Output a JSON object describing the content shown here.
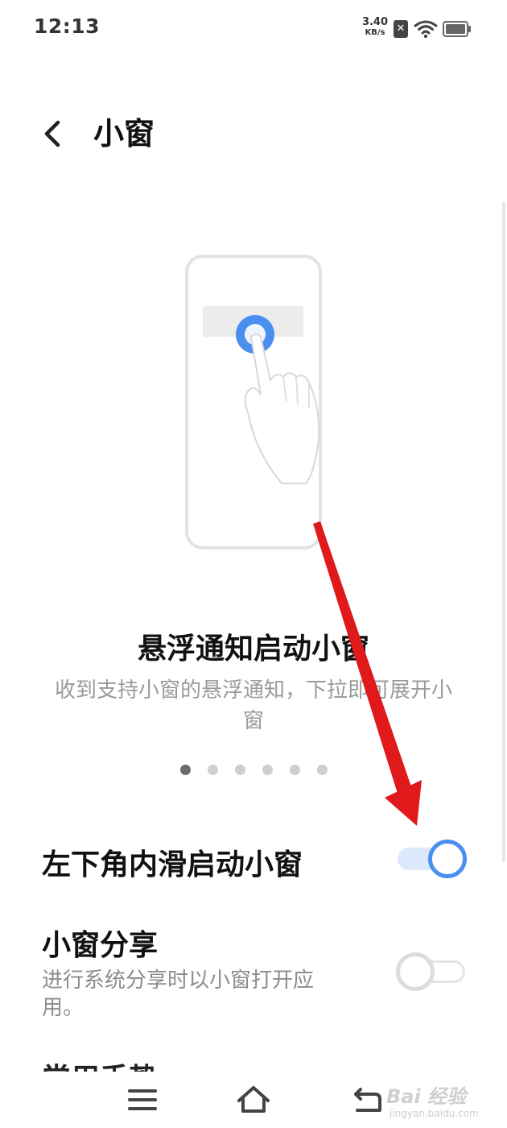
{
  "status_bar": {
    "time": "12:13",
    "net_speed_value": "3.40",
    "net_speed_unit": "KB/s",
    "sim_badge": "✕",
    "icons": [
      "sim-error-icon",
      "wifi-icon",
      "battery-icon"
    ]
  },
  "header": {
    "title": "小窗",
    "back_icon": "chevron-left-icon"
  },
  "promo": {
    "title": "悬浮通知启动小窗",
    "description": "收到支持小窗的悬浮通知，下拉即可展开小窗",
    "pages_total": 6,
    "active_page": 1
  },
  "settings": {
    "items": [
      {
        "title": "左下角内滑启动小窗",
        "enabled": true
      },
      {
        "title": "小窗分享",
        "description": "进行系统分享时以小窗打开应用。",
        "enabled": false
      }
    ],
    "partial_next_title": "常用手势"
  },
  "nav_bar": {
    "icons": [
      "menu-icon",
      "home-icon",
      "back-icon"
    ]
  },
  "watermark": {
    "main": "Bai 经验",
    "sub": "jingyan.baidu.com"
  },
  "colors": {
    "accent": "#4a8ff0",
    "toggle_on_track": "#dce8fb",
    "annotation_arrow": "#e0191b"
  }
}
